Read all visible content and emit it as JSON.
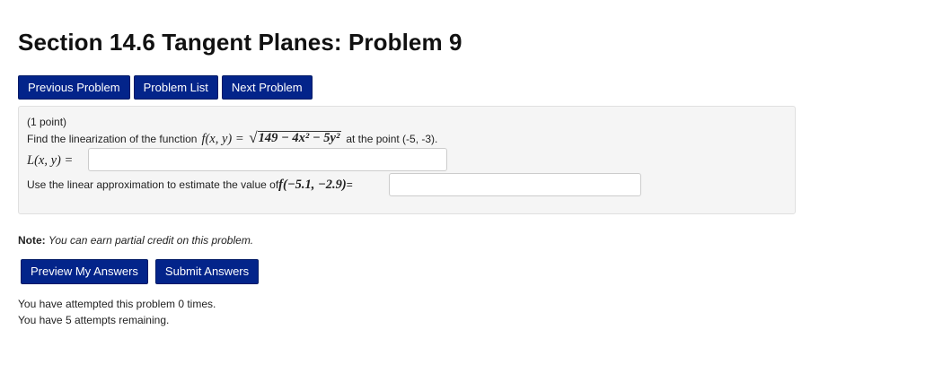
{
  "page_title": "Section 14.6 Tangent Planes: Problem 9",
  "nav": {
    "previous_label": "Previous Problem",
    "list_label": "Problem List",
    "next_label": "Next Problem"
  },
  "problem": {
    "points": "(1 point)",
    "intro": "Find the linearization of the function",
    "function_lhs": "f(x, y) =",
    "function_radicand": "149 − 4x² − 5y²",
    "point_text": "at the point (-5, -3).",
    "linearization_label": "L(x, y) =",
    "linearization_value": "",
    "approx_prompt": "Use the linear approximation to estimate the value of",
    "approx_expr": "f(−5.1, −2.9)",
    "approx_equals": "=",
    "approx_value": ""
  },
  "note": {
    "label": "Note:",
    "text": "You can earn partial credit on this problem."
  },
  "actions": {
    "preview_label": "Preview My Answers",
    "submit_label": "Submit Answers"
  },
  "attempts": {
    "line1": "You have attempted this problem 0 times.",
    "line2": "You have 5 attempts remaining."
  },
  "colors": {
    "button_bg": "#03248a",
    "panel_bg": "#f5f5f5"
  }
}
